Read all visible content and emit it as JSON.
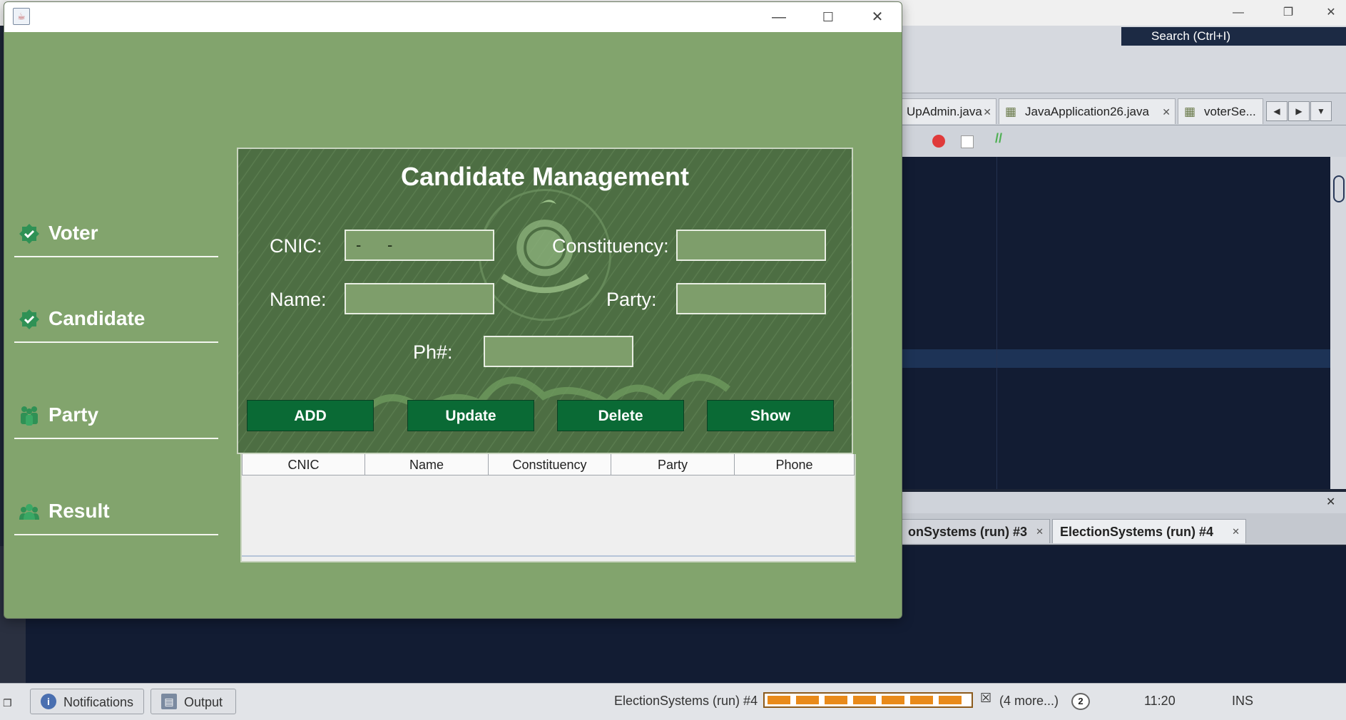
{
  "ide": {
    "search_placeholder": "Search (Ctrl+I)",
    "editor_tabs": [
      {
        "label": "UpAdmin.java"
      },
      {
        "label": "JavaApplication26.java"
      },
      {
        "label": "voterSe..."
      }
    ],
    "output_tabs": [
      {
        "label": "onSystems (run) #3"
      },
      {
        "label": "ElectionSystems (run) #4"
      }
    ],
    "status": {
      "notifications_label": "Notifications",
      "output_label": "Output",
      "task_label": "ElectionSystems (run) #4",
      "more_label": "(4 more...)",
      "badge_count": "2",
      "position": "11:20",
      "mode": "INS"
    }
  },
  "app": {
    "sidebar": [
      {
        "label": "Voter",
        "icon": "check-badge-icon"
      },
      {
        "label": "Candidate",
        "icon": "check-badge-icon"
      },
      {
        "label": "Party",
        "icon": "people-icon"
      },
      {
        "label": "Result",
        "icon": "group-icon"
      }
    ],
    "panel": {
      "title": "Candidate Management",
      "labels": {
        "cnic": "CNIC:",
        "constituency": "Constituency:",
        "name": "Name:",
        "party": "Party:",
        "phone": "Ph#:"
      },
      "values": {
        "cnic": "-      -",
        "constituency": "",
        "name": "",
        "party": "",
        "phone": ""
      },
      "buttons": {
        "add": "ADD",
        "update": "Update",
        "delete": "Delete",
        "show": "Show"
      }
    },
    "table": {
      "columns": [
        "CNIC",
        "Name",
        "Constituency",
        "Party",
        "Phone"
      ],
      "rows": []
    }
  },
  "colors": {
    "window_bg": "#82a46d",
    "panel_bg": "#4d6e43",
    "button_bg": "#0a6a35",
    "ide_editor_bg": "#121c33"
  }
}
